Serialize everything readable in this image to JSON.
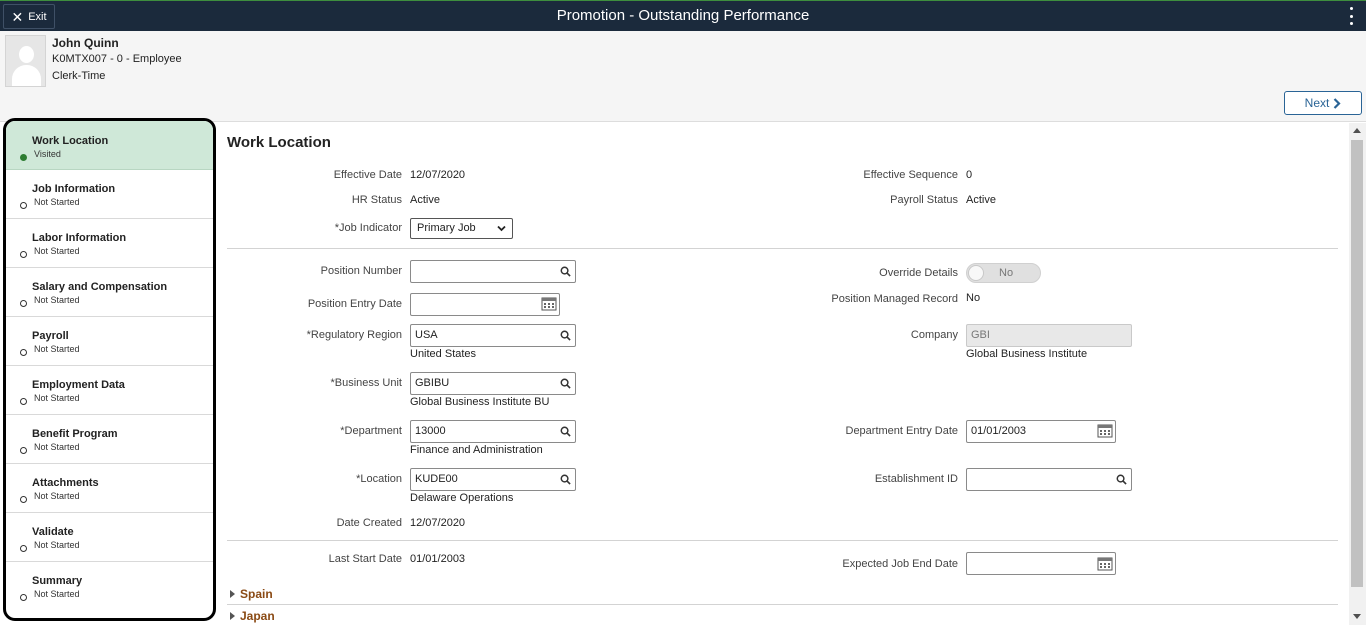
{
  "topbar": {
    "exit_label": "Exit",
    "title": "Promotion - Outstanding Performance"
  },
  "employee": {
    "name": "John Quinn",
    "id_line": "K0MTX007 - 0 - Employee",
    "job": "Clerk-Time"
  },
  "next_label": "Next",
  "nav": [
    {
      "label": "Work Location",
      "status": "Visited"
    },
    {
      "label": "Job Information",
      "status": "Not Started"
    },
    {
      "label": "Labor Information",
      "status": "Not Started"
    },
    {
      "label": "Salary and Compensation",
      "status": "Not Started"
    },
    {
      "label": "Payroll",
      "status": "Not Started"
    },
    {
      "label": "Employment Data",
      "status": "Not Started"
    },
    {
      "label": "Benefit Program",
      "status": "Not Started"
    },
    {
      "label": "Attachments",
      "status": "Not Started"
    },
    {
      "label": "Validate",
      "status": "Not Started"
    },
    {
      "label": "Summary",
      "status": "Not Started"
    }
  ],
  "form": {
    "section_title": "Work Location",
    "effective_date": {
      "label": "Effective Date",
      "value": "12/07/2020"
    },
    "effective_sequence": {
      "label": "Effective Sequence",
      "value": "0"
    },
    "hr_status": {
      "label": "HR Status",
      "value": "Active"
    },
    "payroll_status": {
      "label": "Payroll Status",
      "value": "Active"
    },
    "job_indicator": {
      "label": "*Job Indicator",
      "value": "Primary Job"
    },
    "position_number": {
      "label": "Position Number",
      "value": ""
    },
    "override_details": {
      "label": "Override Details",
      "value": "No"
    },
    "position_entry_date": {
      "label": "Position Entry Date",
      "value": ""
    },
    "position_managed_record": {
      "label": "Position Managed Record",
      "value": "No"
    },
    "regulatory_region": {
      "label": "*Regulatory Region",
      "value": "USA",
      "description": "United States"
    },
    "company": {
      "label": "Company",
      "value": "GBI",
      "description": "Global Business Institute"
    },
    "business_unit": {
      "label": "*Business Unit",
      "value": "GBIBU",
      "description": "Global Business Institute BU"
    },
    "department": {
      "label": "*Department",
      "value": "13000",
      "description": "Finance and Administration"
    },
    "department_entry_date": {
      "label": "Department Entry Date",
      "value": "01/01/2003"
    },
    "location": {
      "label": "*Location",
      "value": "KUDE00",
      "description": "Delaware Operations"
    },
    "establishment_id": {
      "label": "Establishment ID",
      "value": ""
    },
    "date_created": {
      "label": "Date Created",
      "value": "12/07/2020"
    },
    "last_start_date": {
      "label": "Last Start Date",
      "value": "01/01/2003"
    },
    "expected_job_end_date": {
      "label": "Expected Job End Date",
      "value": ""
    },
    "collapsibles": [
      "Spain",
      "Japan"
    ]
  },
  "colors": {
    "topbar_bg": "#1b2a3c",
    "nav_active_bg": "#cfe8d8",
    "visited_dot": "#2e7d32",
    "link_brown": "#8a4a14",
    "next_blue": "#2a6496"
  }
}
